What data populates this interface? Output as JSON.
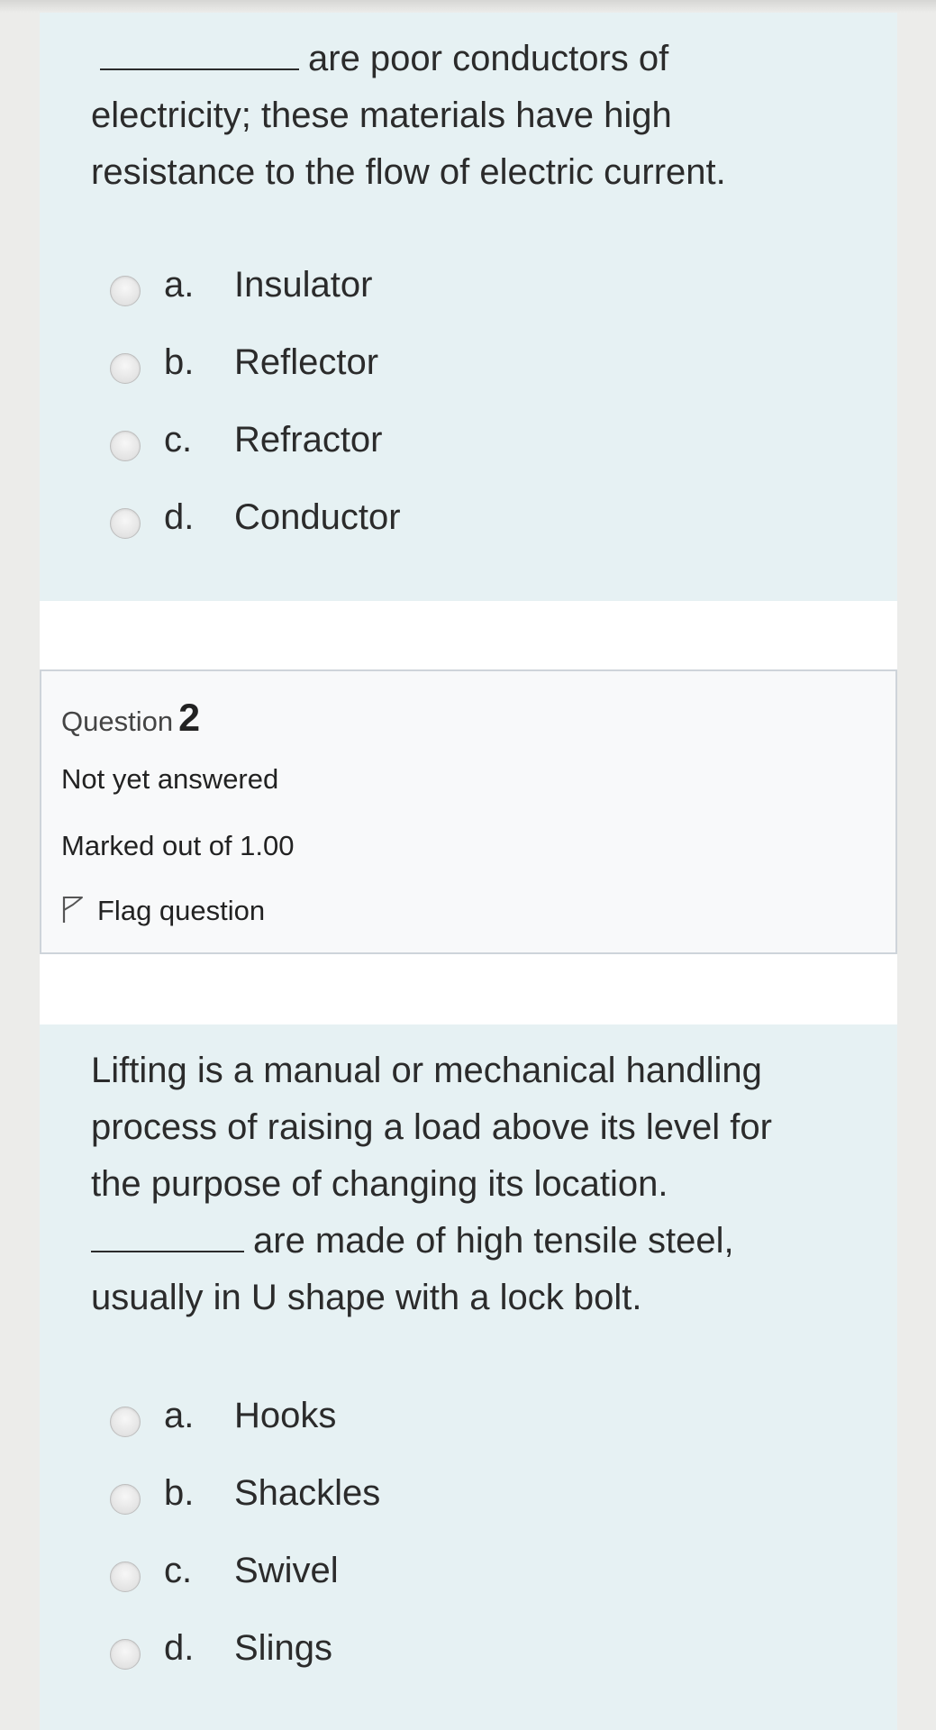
{
  "question1": {
    "text_after_blank": "are poor conductors of electricity; these materials have high resistance to the flow of electric current.",
    "options": [
      {
        "letter": "a.",
        "text": "Insulator"
      },
      {
        "letter": "b.",
        "text": "Reflector"
      },
      {
        "letter": "c.",
        "text": "Refractor"
      },
      {
        "letter": "d.",
        "text": "Conductor"
      }
    ]
  },
  "question2_info": {
    "label": "Question",
    "number": "2",
    "state": "Not yet answered",
    "grade": "Marked out of 1.00",
    "flag_label": "Flag question",
    "flag_icon": "flag-outline-icon"
  },
  "question2": {
    "text_before_blank": "Lifting is a manual or mechanical handling process of raising a load above its level for the purpose of changing its location.",
    "text_after_blank": "are made of high tensile steel, usually in U shape with a lock bolt.",
    "options": [
      {
        "letter": "a.",
        "text": "Hooks"
      },
      {
        "letter": "b.",
        "text": "Shackles"
      },
      {
        "letter": "c.",
        "text": "Swivel"
      },
      {
        "letter": "d.",
        "text": "Slings"
      }
    ]
  },
  "colors": {
    "formulation_bg": "#e6f1f3",
    "info_bg": "#f8f9fa",
    "info_border": "#ced4da",
    "page_bg": "#ececea"
  }
}
